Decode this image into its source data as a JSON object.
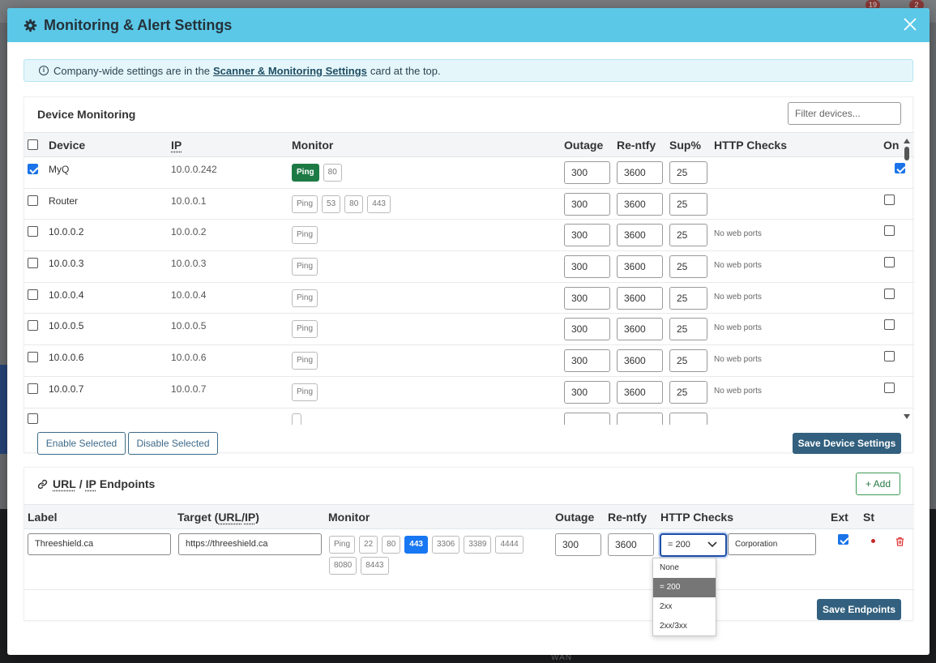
{
  "background": {
    "badge1": "19",
    "badge2": "2",
    "wan_label": "WAN"
  },
  "modal": {
    "title": "Monitoring & Alert Settings",
    "info": {
      "prefix": "Company-wide settings are in the",
      "link": "Scanner & Monitoring Settings",
      "suffix": "card at the top."
    }
  },
  "devices": {
    "title": "Device Monitoring",
    "filter_placeholder": "Filter devices...",
    "headers": {
      "device": "Device",
      "ip": "IP",
      "monitor": "Monitor",
      "outage": "Outage",
      "renotify": "Re-ntfy",
      "sup": "Sup%",
      "http": "HTTP Checks",
      "on": "On"
    },
    "rows": [
      {
        "selected": true,
        "name": "MyQ",
        "ip": "10.0.0.242",
        "ports": [
          {
            "label": "Ping",
            "style": "green"
          },
          {
            "label": "80",
            "style": ""
          }
        ],
        "outage": "300",
        "renotify": "3600",
        "sup": "25",
        "http": "",
        "on": true
      },
      {
        "selected": false,
        "name": "Router",
        "ip": "10.0.0.1",
        "ports": [
          {
            "label": "Ping",
            "style": ""
          },
          {
            "label": "53",
            "style": ""
          },
          {
            "label": "80",
            "style": ""
          },
          {
            "label": "443",
            "style": ""
          }
        ],
        "outage": "300",
        "renotify": "3600",
        "sup": "25",
        "http": "",
        "on": false
      },
      {
        "selected": false,
        "name": "10.0.0.2",
        "ip": "10.0.0.2",
        "ports": [
          {
            "label": "Ping",
            "style": ""
          }
        ],
        "outage": "300",
        "renotify": "3600",
        "sup": "25",
        "http": "No web ports",
        "on": false
      },
      {
        "selected": false,
        "name": "10.0.0.3",
        "ip": "10.0.0.3",
        "ports": [
          {
            "label": "Ping",
            "style": ""
          }
        ],
        "outage": "300",
        "renotify": "3600",
        "sup": "25",
        "http": "No web ports",
        "on": false
      },
      {
        "selected": false,
        "name": "10.0.0.4",
        "ip": "10.0.0.4",
        "ports": [
          {
            "label": "Ping",
            "style": ""
          }
        ],
        "outage": "300",
        "renotify": "3600",
        "sup": "25",
        "http": "No web ports",
        "on": false
      },
      {
        "selected": false,
        "name": "10.0.0.5",
        "ip": "10.0.0.5",
        "ports": [
          {
            "label": "Ping",
            "style": ""
          }
        ],
        "outage": "300",
        "renotify": "3600",
        "sup": "25",
        "http": "No web ports",
        "on": false
      },
      {
        "selected": false,
        "name": "10.0.0.6",
        "ip": "10.0.0.6",
        "ports": [
          {
            "label": "Ping",
            "style": ""
          }
        ],
        "outage": "300",
        "renotify": "3600",
        "sup": "25",
        "http": "No web ports",
        "on": false
      },
      {
        "selected": false,
        "name": "10.0.0.7",
        "ip": "10.0.0.7",
        "ports": [
          {
            "label": "Ping",
            "style": ""
          }
        ],
        "outage": "300",
        "renotify": "3600",
        "sup": "25",
        "http": "No web ports",
        "on": false
      }
    ],
    "enable_label": "Enable Selected",
    "disable_label": "Disable Selected",
    "save_label": "Save Device Settings"
  },
  "endpoints": {
    "title_url": "URL",
    "title_sep": "/",
    "title_ip": "IP",
    "title_rest": "Endpoints",
    "add_label": "+ Add",
    "headers": {
      "label": "Label",
      "target_prefix": "Target (",
      "target_url": "URL",
      "target_sep": "/",
      "target_ip": "IP",
      "target_suffix": ")",
      "monitor": "Monitor",
      "outage": "Outage",
      "renotify": "Re-ntfy",
      "http": "HTTP Checks",
      "ext": "Ext",
      "st": "St"
    },
    "row": {
      "label": "Threeshield.ca",
      "target": "https://threeshield.ca",
      "ports": [
        {
          "label": "Ping",
          "style": ""
        },
        {
          "label": "22",
          "style": ""
        },
        {
          "label": "80",
          "style": ""
        },
        {
          "label": "443",
          "style": "blue"
        },
        {
          "label": "3306",
          "style": ""
        },
        {
          "label": "3389",
          "style": ""
        },
        {
          "label": "4444",
          "style": ""
        },
        {
          "label": "8080",
          "style": ""
        },
        {
          "label": "8443",
          "style": ""
        }
      ],
      "outage": "300",
      "renotify": "3600",
      "http_check": "= 200",
      "http_match": "Corporation",
      "ext": true
    },
    "http_options": [
      "None",
      "= 200",
      "2xx",
      "2xx/3xx"
    ],
    "http_selected_index": 1,
    "save_label": "Save Endpoints"
  },
  "colors": {
    "header": "#5bc8e8",
    "primary": "#32607e",
    "green": "#1e7a45",
    "blue": "#1877f2"
  }
}
